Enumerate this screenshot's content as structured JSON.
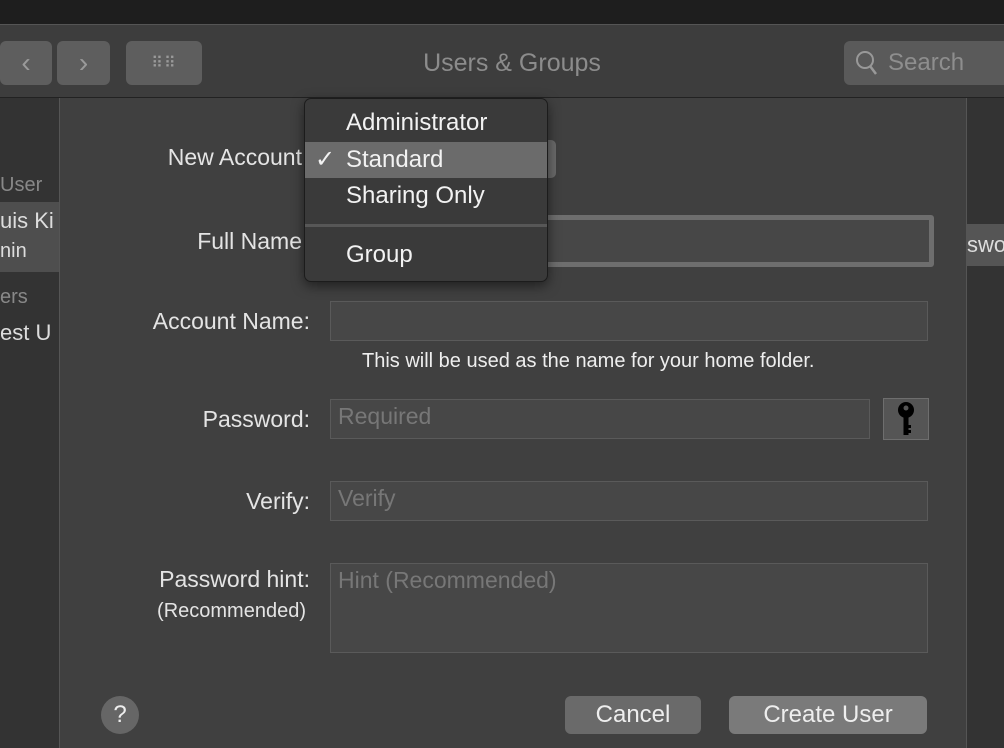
{
  "window": {
    "title": "Users & Groups",
    "search_placeholder": "Search"
  },
  "sidebar": {
    "items": [
      "User",
      "uis Ki",
      "nin",
      "ers",
      "est U"
    ]
  },
  "right_partial": "swo",
  "form": {
    "new_account_label": "New Account",
    "full_name_label": "Full Name",
    "account_name_label": "Account Name:",
    "account_name_hint": "This will be used as the name for your home folder.",
    "password_label": "Password:",
    "password_placeholder": "Required",
    "verify_label": "Verify:",
    "verify_placeholder": "Verify",
    "hint_label": "Password hint:",
    "hint_sublabel": "(Recommended)",
    "hint_placeholder": "Hint (Recommended)",
    "help": "?",
    "cancel": "Cancel",
    "create": "Create User"
  },
  "dropdown": {
    "items": [
      "Administrator",
      "Standard",
      "Sharing Only",
      "Group"
    ],
    "selected": "Standard",
    "checkmark": "✓"
  }
}
